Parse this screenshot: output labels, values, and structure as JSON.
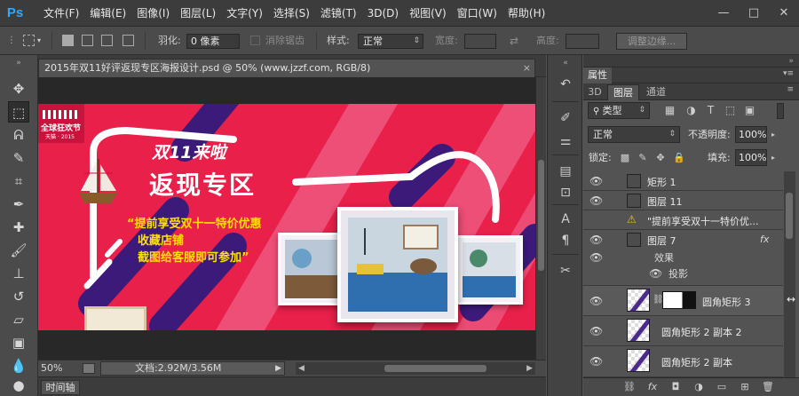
{
  "app": {
    "logo": "Ps",
    "menu": [
      "文件(F)",
      "编辑(E)",
      "图像(I)",
      "图层(L)",
      "文字(Y)",
      "选择(S)",
      "滤镜(T)",
      "3D(D)",
      "视图(V)",
      "窗口(W)",
      "帮助(H)"
    ],
    "window_controls": [
      "—",
      "□",
      "✕"
    ]
  },
  "options_bar": {
    "feather_label": "羽化:",
    "feather_value": "0 像素",
    "antialias_label": "消除锯齿",
    "style_label": "样式:",
    "style_value": "正常",
    "width_label": "宽度:",
    "height_label": "高度:",
    "refine_edge_label": "调整边缘..."
  },
  "document": {
    "tab_title": "2015年双11好评返现专区海报设计.psd @ 50% (www.jzzf.com, RGB/8)",
    "tab_close": "×",
    "zoom": "50%",
    "doc_info": "文档:2.92M/3.56M",
    "timeline_tab": "时间轴"
  },
  "artwork": {
    "badge_text": "全球狂欢节",
    "badge_sub": "天猫 · 2015",
    "headline_1": "双11来啦",
    "headline_2": "返现专区",
    "line_1": "“提前享受双十一特价优惠",
    "line_2": "收藏店铺",
    "line_3": "截图给客服即可参加”",
    "colors": {
      "bg": "#e8204a",
      "stripe": "#e9547d",
      "purple": "#3a1a78",
      "yellow": "#ffe100"
    }
  },
  "panels": {
    "properties_tab": "属性",
    "tabs": [
      "3D",
      "图层",
      "通道"
    ],
    "filter_type": "类型",
    "blend_mode": "正常",
    "opacity_label": "不透明度:",
    "opacity_value": "100%",
    "lock_label": "锁定:",
    "fill_label": "填充:",
    "fill_value": "100%",
    "layers": [
      {
        "name": "矩形 1"
      },
      {
        "name": "图层 11"
      },
      {
        "name": "\"提前享受双十一特价优..."
      },
      {
        "name": "图层 7",
        "fx": "fx",
        "effects_label": "效果",
        "effect": "投影"
      },
      {
        "name": "圆角矩形 3"
      },
      {
        "name": "圆角矩形 2 副本 2"
      },
      {
        "name": "圆角矩形 2 副本"
      }
    ]
  }
}
